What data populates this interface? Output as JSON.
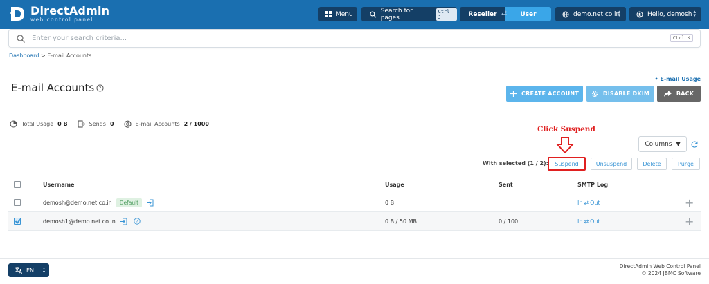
{
  "header": {
    "logo_title": "DirectAdmin",
    "logo_subtitle": "web control panel",
    "menu_label": "Menu",
    "search_pages_label": "Search for pages",
    "search_pages_shortcut": "Ctrl J",
    "role_reseller": "Reseller",
    "role_user": "User",
    "domain": "demo.net.co.in",
    "greeting": "Hello, demosh"
  },
  "search": {
    "placeholder": "Enter your search criteria...",
    "shortcut": "Ctrl K"
  },
  "breadcrumb": {
    "home": "Dashboard",
    "separator": ">",
    "current": "E-mail Accounts"
  },
  "page": {
    "title": "E-mail Accounts",
    "usage_link": "• E-mail Usage"
  },
  "actions": {
    "create": "CREATE ACCOUNT",
    "disable_dkim": "DISABLE DKIM",
    "back": "BACK"
  },
  "stats": {
    "total_usage_label": "Total Usage",
    "total_usage_value": "0 B",
    "sends_label": "Sends",
    "sends_value": "0",
    "accounts_label": "E-mail Accounts",
    "accounts_value": "2 / 1000"
  },
  "annotation": {
    "text": "Click Suspend",
    "color": "#e02020"
  },
  "toolbar": {
    "columns_label": "Columns",
    "with_selected": "With selected (1 / 2):",
    "suspend": "Suspend",
    "unsuspend": "Unsuspend",
    "delete": "Delete",
    "purge": "Purge"
  },
  "table": {
    "headers": {
      "username": "Username",
      "usage": "Usage",
      "sent": "Sent",
      "smtp_log": "SMTP Log"
    },
    "rows": [
      {
        "username": "demosh@demo.net.co.in",
        "badge": "Default",
        "usage": "0 B",
        "sent": "",
        "smtp_in": "In",
        "smtp_arrow": "⇄",
        "smtp_out": "Out",
        "checked": false
      },
      {
        "username": "demosh1@demo.net.co.in",
        "badge": "",
        "usage": "0 B / 50 MB",
        "sent": "0 / 100",
        "smtp_in": "In",
        "smtp_arrow": "⇄",
        "smtp_out": "Out",
        "checked": true
      }
    ]
  },
  "footer": {
    "language": "EN",
    "product": "DirectAdmin Web Control Panel",
    "copyright": "© 2024 JBMC Software"
  },
  "colors": {
    "header_bg": "#1a6fb0",
    "header_button": "#143f66",
    "accent": "#3aa6e8",
    "back_button": "#676767"
  }
}
